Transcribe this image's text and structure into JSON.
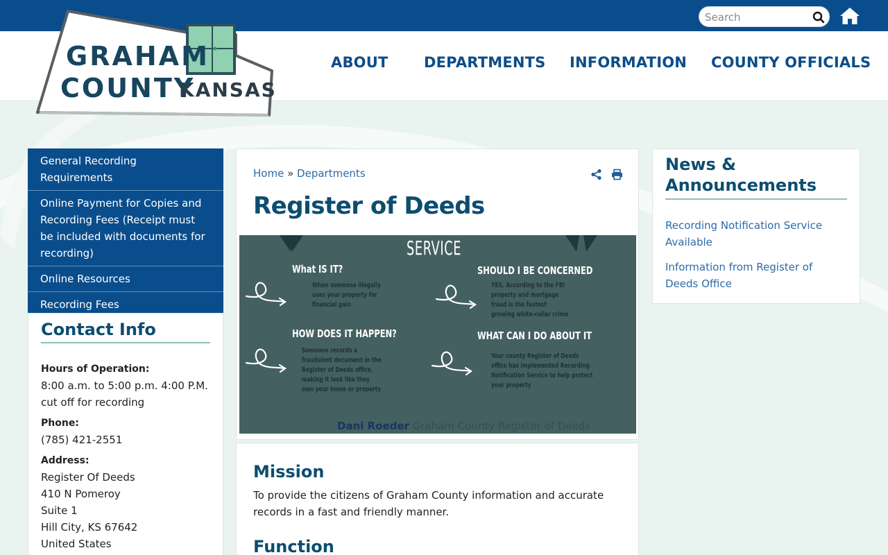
{
  "header": {
    "search_placeholder": "Search",
    "logo": {
      "line1": "GRAHAM",
      "line2": "COUNTY",
      "line3": "KANSAS"
    },
    "nav": [
      {
        "label": "ABOUT"
      },
      {
        "label": "DEPARTMENTS"
      },
      {
        "label": "INFORMATION"
      },
      {
        "label": "COUNTY OFFICIALS"
      }
    ]
  },
  "sidebar": {
    "items": [
      {
        "label": "General Recording Requirements"
      },
      {
        "label": "Online Payment for Copies and Recording Fees (Receipt must be included with documents for recording)"
      },
      {
        "label": "Online Resources"
      },
      {
        "label": "Recording Fees"
      }
    ]
  },
  "contact": {
    "title": "Contact Info",
    "hours_label": "Hours of Operation:",
    "hours_value": "8:00 a.m. to 5:00 p.m.  4:00 P.M. cut off for recording",
    "phone_label": "Phone:",
    "phone_value": "(785) 421-2551",
    "address_label": "Address:",
    "address_lines": [
      "Register Of Deeds",
      "410 N Pomeroy",
      "Suite 1",
      "Hill City, KS 67642",
      "United States"
    ]
  },
  "main": {
    "breadcrumb": {
      "home": "Home",
      "sep": "»",
      "section": "Departments"
    },
    "title": "Register of Deeds",
    "hero": {
      "top": "SERVICE",
      "q1": "What IS IT?",
      "a1": [
        "When someone illegally",
        "uses your property for",
        "financial gain"
      ],
      "q2": "SHOULD I BE CONCERNED",
      "a2": [
        "YES, According to the FBI",
        "property and mortgage",
        "fraud is the fastest",
        "growing white-collar crime"
      ],
      "q3": "HOW DOES IT HAPPEN?",
      "a3": [
        "Someone records a",
        "fraudulent document in the",
        "Register of Deeds office,",
        "making it look like they",
        "own your home or property"
      ],
      "q4": "WHAT CAN I DO ABOUT IT",
      "a4": [
        "Your county Register of Deeds",
        "office has implemented Recording",
        "Notification Service to help protect",
        "your property"
      ],
      "caption_name": "Dani Roeder",
      "caption_role": "Graham County Register of Deeds"
    },
    "mission_title": "Mission",
    "mission_body": "To provide the citizens of Graham County information and accurate records in a fast and friendly manner.",
    "function_title": "Function"
  },
  "news": {
    "title": "News & Announcements",
    "items": [
      {
        "label": "Recording Notification Service Available"
      },
      {
        "label": "Information from Register of Deeds Office"
      }
    ]
  },
  "colors": {
    "brand_blue": "#0a4d8c",
    "title_blue": "#0c4d70",
    "link_blue": "#2c6aa8",
    "accent_green": "#8ec3ae",
    "page_bg": "#e9f3ef"
  }
}
